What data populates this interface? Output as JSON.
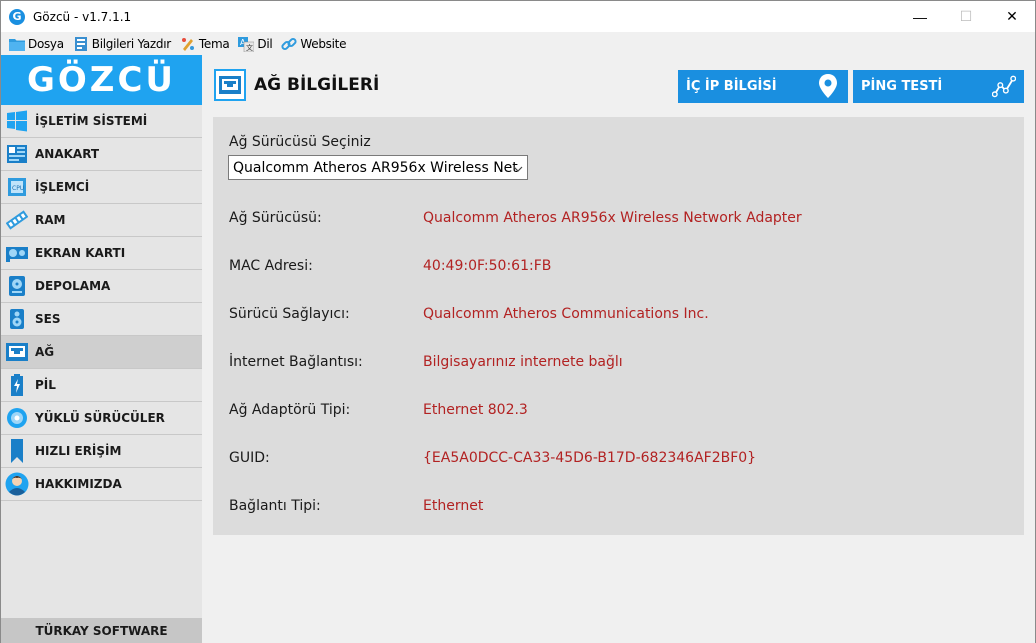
{
  "window": {
    "title": "Gözcü - v1.7.1.1",
    "app_icon_letter": "G",
    "minimize": "—",
    "maximize": "☐",
    "close": "✕"
  },
  "menu": {
    "items": [
      {
        "label": "Dosya",
        "icon": "folder-icon"
      },
      {
        "label": "Bilgileri Yazdır",
        "icon": "print-icon"
      },
      {
        "label": "Tema",
        "icon": "theme-icon"
      },
      {
        "label": "Dil",
        "icon": "language-icon"
      },
      {
        "label": "Website",
        "icon": "link-icon"
      }
    ]
  },
  "sidebar": {
    "logo": "GÖZCÜ",
    "items": [
      {
        "label": "İŞLETİM SİSTEMİ",
        "icon": "windows-icon"
      },
      {
        "label": "ANAKART",
        "icon": "motherboard-icon"
      },
      {
        "label": "İŞLEMCİ",
        "icon": "cpu-icon"
      },
      {
        "label": "RAM",
        "icon": "ram-icon"
      },
      {
        "label": "EKRAN KARTI",
        "icon": "gpu-icon"
      },
      {
        "label": "DEPOLAMA",
        "icon": "storage-icon"
      },
      {
        "label": "SES",
        "icon": "speaker-icon"
      },
      {
        "label": "AĞ",
        "icon": "network-icon",
        "active": true
      },
      {
        "label": "PİL",
        "icon": "battery-icon"
      },
      {
        "label": "YÜKLÜ SÜRÜCÜLER",
        "icon": "driver-disc-icon"
      },
      {
        "label": "HIZLI ERİŞİM",
        "icon": "bookmark-icon"
      },
      {
        "label": "HAKKIMIZDA",
        "icon": "user-icon"
      }
    ],
    "footer": "TÜRKAY SOFTWARE"
  },
  "main": {
    "title": "AĞ BİLGİLERİ",
    "buttons": {
      "ip": "İÇ İP BİLGİSİ",
      "ping": "PİNG TESTİ"
    },
    "select": {
      "label": "Ağ Sürücüsü Seçiniz",
      "value": "Qualcomm Atheros AR956x Wireless Net"
    },
    "info": [
      {
        "label": "Ağ Sürücüsü:",
        "value": "Qualcomm Atheros AR956x Wireless Network Adapter"
      },
      {
        "label": "MAC Adresi:",
        "value": "40:49:0F:50:61:FB"
      },
      {
        "label": "Sürücü Sağlayıcı:",
        "value": "Qualcomm Atheros Communications Inc."
      },
      {
        "label": "İnternet Bağlantısı:",
        "value": "Bilgisayarınız internete bağlı"
      },
      {
        "label": "Ağ Adaptörü Tipi:",
        "value": "Ethernet 802.3"
      },
      {
        "label": "GUID:",
        "value": "{EA5A0DCC-CA33-45D6-B17D-682346AF2BF0}"
      },
      {
        "label": "Bağlantı Tipi:",
        "value": "Ethernet"
      }
    ]
  },
  "colors": {
    "accent": "#1FA3F0",
    "button": "#1A8FE0",
    "value_text": "#B22222"
  }
}
